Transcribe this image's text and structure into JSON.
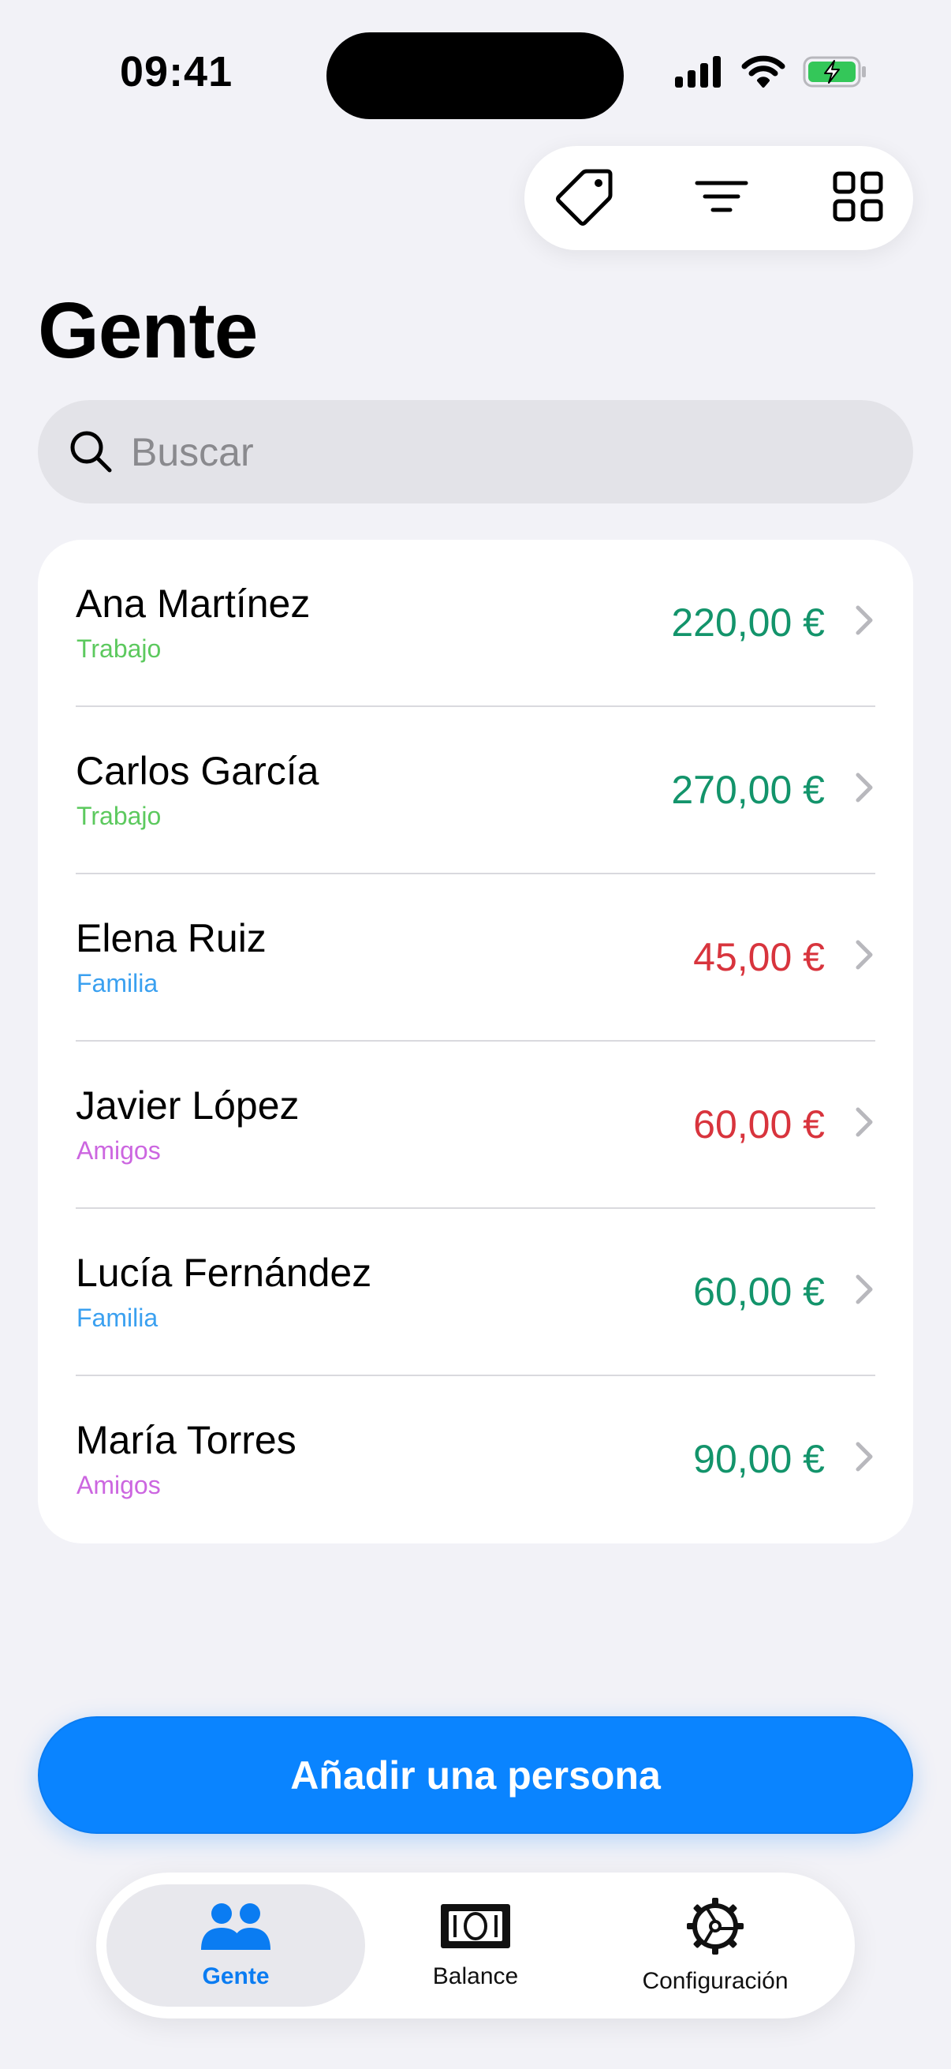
{
  "status_bar": {
    "time": "09:41"
  },
  "toolbar": {
    "icons": [
      "tag-icon",
      "filter-lines-icon",
      "grid-icon"
    ]
  },
  "page": {
    "title": "Gente"
  },
  "search": {
    "placeholder": "Buscar",
    "value": ""
  },
  "colors": {
    "accent": "#0a84ff",
    "positive": "#13946b",
    "negative": "#d8343d",
    "tag_trabajo": "#5cc95e",
    "tag_familia": "#3aa0f0",
    "tag_amigos": "#cc66e0"
  },
  "people": [
    {
      "name": "Ana Martínez",
      "tag": "Trabajo",
      "amount": "220,00 €",
      "sign": "positive"
    },
    {
      "name": "Carlos García",
      "tag": "Trabajo",
      "amount": "270,00 €",
      "sign": "positive"
    },
    {
      "name": "Elena Ruiz",
      "tag": "Familia",
      "amount": "45,00 €",
      "sign": "negative"
    },
    {
      "name": "Javier López",
      "tag": "Amigos",
      "amount": "60,00 €",
      "sign": "negative"
    },
    {
      "name": "Lucía Fernández",
      "tag": "Familia",
      "amount": "60,00 €",
      "sign": "positive"
    },
    {
      "name": "María Torres",
      "tag": "Amigos",
      "amount": "90,00 €",
      "sign": "positive"
    }
  ],
  "actions": {
    "add_person_label": "Añadir una persona"
  },
  "tab_bar": {
    "tabs": [
      {
        "label": "Gente",
        "icon": "people-icon",
        "active": true
      },
      {
        "label": "Balance",
        "icon": "banknote-icon",
        "active": false
      },
      {
        "label": "Configuración",
        "icon": "gear-icon",
        "active": false
      }
    ]
  }
}
